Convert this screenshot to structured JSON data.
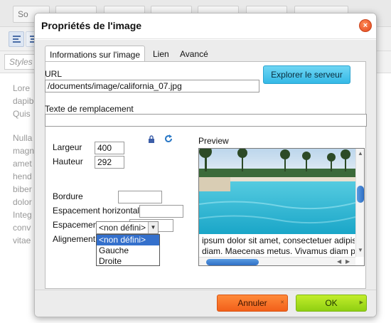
{
  "editor": {
    "toolbar_tabs": [
      "So",
      "",
      "",
      "",
      "",
      "",
      ""
    ],
    "styles_placeholder": "Styles",
    "content_lines": [
      "Lore",
      "dapib",
      "Quis",
      "",
      "Nulla",
      "magn",
      "amet",
      "hend",
      "biber",
      "dolor",
      "Integ",
      "conv",
      "vitae"
    ]
  },
  "dialog": {
    "title": "Propriétés de l'image",
    "close_symbol": "×",
    "tabs": [
      {
        "label": "Informations sur l'image",
        "active": true
      },
      {
        "label": "Lien",
        "active": false
      },
      {
        "label": "Avancé",
        "active": false
      }
    ],
    "url": {
      "label": "URL",
      "value": "/documents/image/california_07.jpg",
      "browse_label": "Explorer le serveur"
    },
    "alt": {
      "label": "Texte de remplacement",
      "value": ""
    },
    "width": {
      "label": "Largeur",
      "value": "400"
    },
    "height": {
      "label": "Hauteur",
      "value": "292"
    },
    "border": {
      "label": "Bordure",
      "value": ""
    },
    "hspace": {
      "label": "Espacement horizontal",
      "value": ""
    },
    "vspace": {
      "label": "Espacement vertical",
      "value": ""
    },
    "align": {
      "label": "Alignement",
      "selected": "<non défini>",
      "options": [
        "<non défini>",
        "Gauche",
        "Droite"
      ]
    },
    "preview": {
      "label": "Preview",
      "text_line1": "ipsum dolor sit amet, consectetuer adipis",
      "text_line2": "diam. Maecenas metus. Vivamus diam p"
    },
    "footer": {
      "cancel_label": "Annuler",
      "ok_label": "OK"
    }
  },
  "colors": {
    "cancel": "#f2601a",
    "ok": "#8fcf12",
    "browse": "#34b9e6",
    "close": "#e2461c",
    "selected_option": "#3470cc"
  }
}
